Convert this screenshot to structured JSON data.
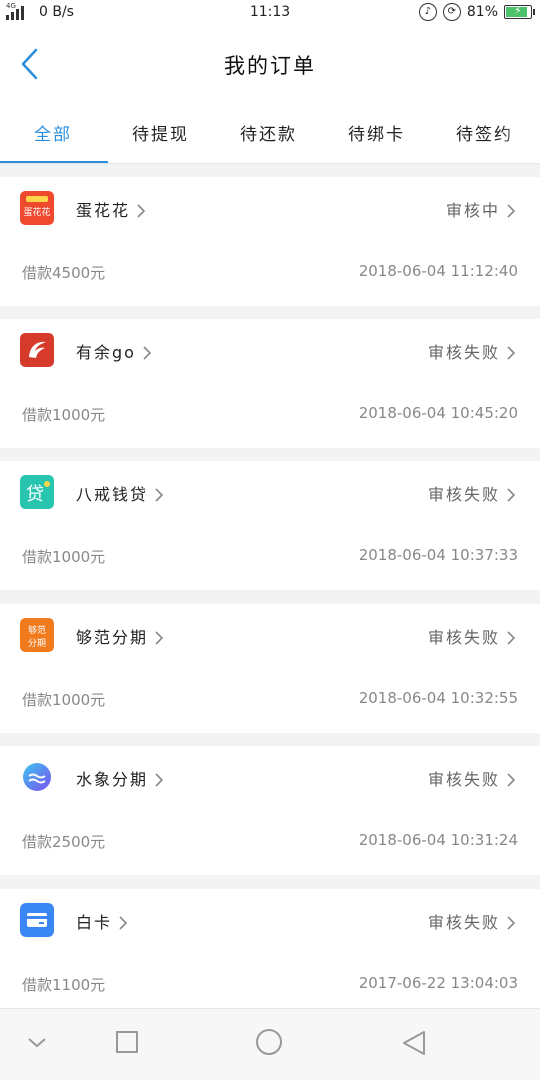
{
  "status_bar": {
    "network": "0 B/s",
    "time": "11:13",
    "battery": "81%",
    "battery_level": 0.81,
    "signal_tag": "4G"
  },
  "header": {
    "title": "我的订单",
    "back_icon": "chevron-left-icon"
  },
  "tabs": [
    {
      "label": "全部",
      "active": true
    },
    {
      "label": "待提现",
      "active": false
    },
    {
      "label": "待还款",
      "active": false
    },
    {
      "label": "待绑卡",
      "active": false
    },
    {
      "label": "待签约",
      "active": false
    }
  ],
  "orders": [
    {
      "name": "蛋花花",
      "status": "审核中",
      "amount": "借款4500元",
      "date": "2018-06-04 11:12:40",
      "logo_text": "蛋花花",
      "logo_color": "#f04a2e"
    },
    {
      "name": "有余go",
      "status": "审核失败",
      "amount": "借款1000元",
      "date": "2018-06-04 10:45:20",
      "logo_text": "",
      "logo_color": "#d63a2b"
    },
    {
      "name": "八戒钱贷",
      "status": "审核失败",
      "amount": "借款1000元",
      "date": "2018-06-04 10:37:33",
      "logo_text": "贷",
      "logo_color": "#27c4b0"
    },
    {
      "name": "够范分期",
      "status": "审核失败",
      "amount": "借款1000元",
      "date": "2018-06-04 10:32:55",
      "logo_text": "够范分期",
      "logo_color": "#f07a1c"
    },
    {
      "name": "水象分期",
      "status": "审核失败",
      "amount": "借款2500元",
      "date": "2018-06-04 10:31:24",
      "logo_text": "",
      "logo_color": "#5b7ef0"
    },
    {
      "name": "白卡",
      "status": "审核失败",
      "amount": "借款1100元",
      "date": "2017-06-22 13:04:03",
      "logo_text": "",
      "logo_color": "#3a86f5"
    }
  ],
  "bottom_nav": {
    "icons": [
      "chevron-down-icon",
      "square-icon",
      "circle-icon",
      "triangle-back-icon"
    ]
  },
  "colors": {
    "accent": "#2b8fde",
    "background": "#f3f3f3"
  }
}
